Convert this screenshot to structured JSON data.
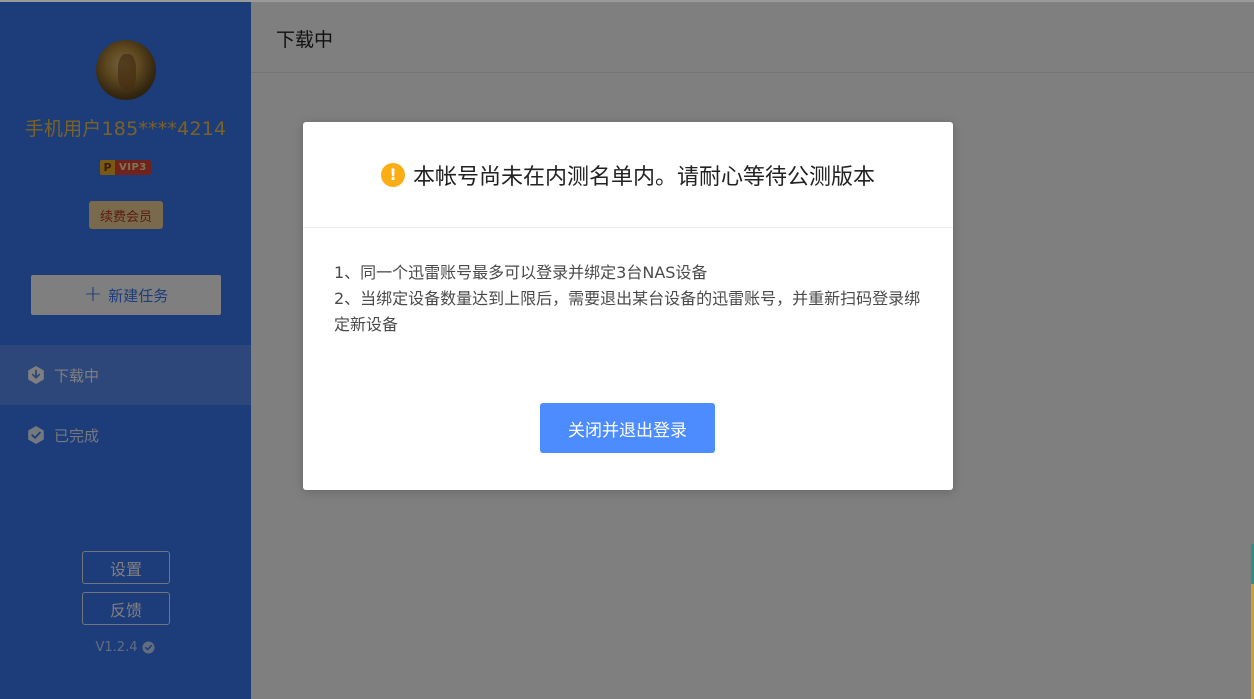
{
  "sidebar": {
    "username": "手机用户185****4214",
    "vip_letter": "P",
    "vip_label": "VIP3",
    "renew_label": "续费会员",
    "new_task_label": "新建任务",
    "nav": [
      {
        "label": "下载中",
        "active": true
      },
      {
        "label": "已完成",
        "active": false
      }
    ],
    "settings_label": "设置",
    "feedback_label": "反馈",
    "version": "V1.2.4"
  },
  "main": {
    "title": "下载中"
  },
  "modal": {
    "title": "本帐号尚未在内测名单内。请耐心等待公测版本",
    "lines": [
      "1、同一个迅雷账号最多可以登录并绑定3台NAS设备",
      "2、当绑定设备数量达到上限后，需要退出某台设备的迅雷账号，并重新扫码登录绑定新设备"
    ],
    "button_label": "关闭并退出登录"
  },
  "colors": {
    "sidebar_bg": "#3b78f5",
    "accent": "#4d8cff",
    "warning": "#faad14",
    "username": "#f4c44a"
  },
  "icons": [
    "plus-icon",
    "download-icon",
    "check-icon",
    "verified-icon",
    "warning-icon"
  ]
}
